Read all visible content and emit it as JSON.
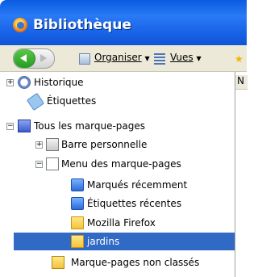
{
  "window": {
    "title": "Bibliothèque"
  },
  "toolbar": {
    "organize_label": "Organiser",
    "views_label": "Vues"
  },
  "tree": {
    "items": [
      {
        "label": "Historique"
      },
      {
        "label": "Étiquettes"
      },
      {
        "label": "Tous les marque-pages"
      },
      {
        "label": "Barre personnelle"
      },
      {
        "label": "Menu des marque-pages"
      },
      {
        "label": "Marqués récemment"
      },
      {
        "label": "Étiquettes récentes"
      },
      {
        "label": "Mozilla Firefox"
      },
      {
        "label": "jardins"
      },
      {
        "label": "Marque-pages non classés"
      }
    ]
  },
  "right_pane": {
    "header_partial": "N"
  },
  "colors": {
    "titlebar": "#2a7af6",
    "selection": "#316ac5",
    "toolbar_bg": "#ece9d8"
  }
}
